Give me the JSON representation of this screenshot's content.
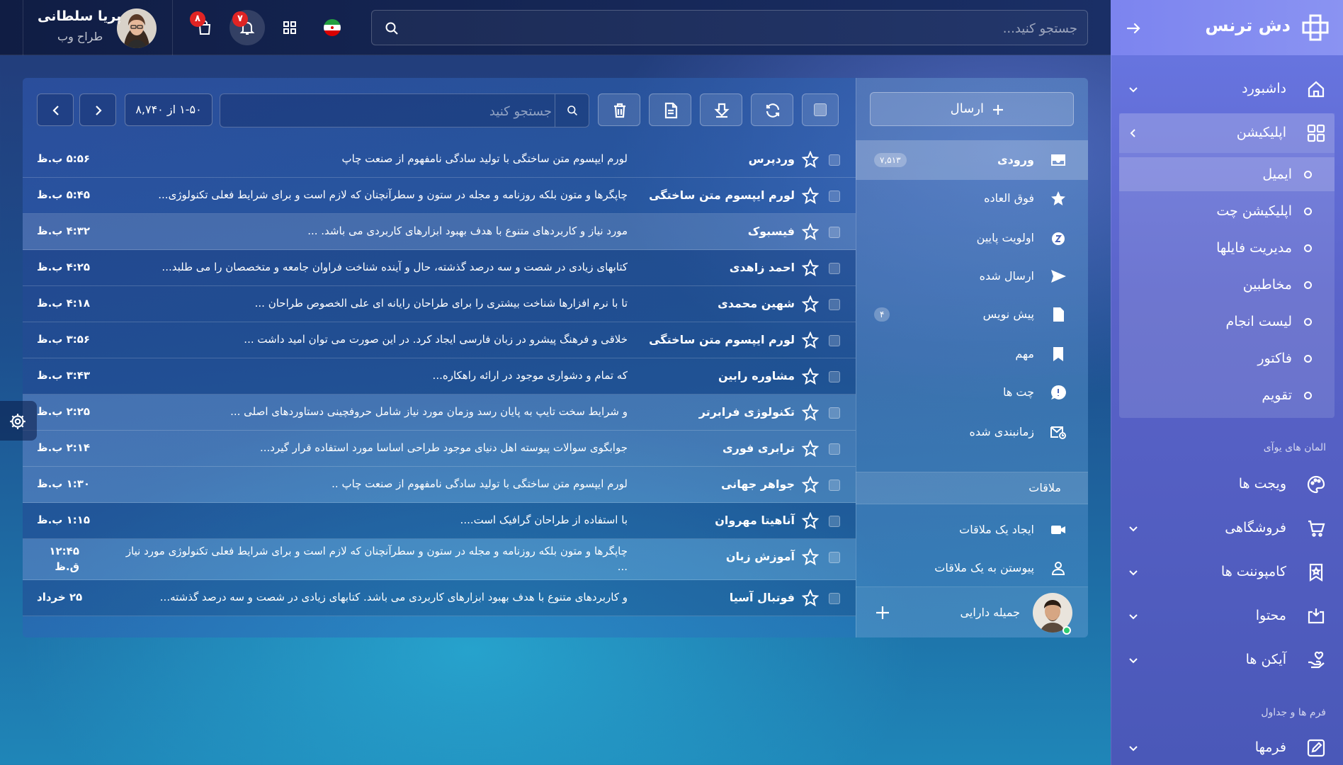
{
  "app": {
    "brand": "دش ترنس"
  },
  "topbar": {
    "search_placeholder": "جستجو کنید...",
    "flag": "iran-flag",
    "notifications_count": "۷",
    "cart_count": "۸",
    "user": {
      "name": "پریا سلطانی",
      "role": "طراح وب"
    }
  },
  "sidebar": {
    "dashboard": "داشبورد",
    "apps": "اپلیکیشن",
    "submenu": [
      {
        "label": "ایمیل",
        "active": true
      },
      {
        "label": "اپلیکیشن چت"
      },
      {
        "label": "مدیریت فایلها"
      },
      {
        "label": "مخاطبین"
      },
      {
        "label": "لیست انجام"
      },
      {
        "label": "فاکتور"
      },
      {
        "label": "تقویم"
      }
    ],
    "section_ui": "المان های یوآی",
    "widgets": "ویجت ها",
    "shop": "فروشگاهی",
    "components": "کامپوننت ها",
    "content": "محتوا",
    "icons": "آیکن ها",
    "section_forms": "فرم ها و جداول",
    "forms": "فرمها"
  },
  "mail": {
    "compose": "ارسال",
    "folders": [
      {
        "label": "ورودی",
        "count": "۷,۵۱۳",
        "icon": "inbox-icon"
      },
      {
        "label": "فوق العاده",
        "count": "",
        "icon": "star-icon"
      },
      {
        "label": "اولویت پایین",
        "count": "",
        "icon": "snooze-icon"
      },
      {
        "label": "ارسال شده",
        "count": "",
        "icon": "send-icon"
      },
      {
        "label": "پیش نویس",
        "count": "۴",
        "icon": "draft-icon"
      },
      {
        "label": "مهم",
        "count": "",
        "icon": "bookmark-icon"
      },
      {
        "label": "چت ها",
        "count": "",
        "icon": "chat-icon"
      },
      {
        "label": "زمانبندی شده",
        "count": "",
        "icon": "scheduled-icon"
      }
    ],
    "meetings_title": "ملاقات",
    "meetings": [
      {
        "label": "ایجاد یک ملاقات",
        "icon": "video-icon"
      },
      {
        "label": "پیوستن به یک ملاقات",
        "icon": "people-icon"
      }
    ],
    "contact": {
      "name": "جمیله دارایی"
    },
    "search_placeholder": "جستجو کنید",
    "pager": "۱-۵۰ از ۸,۷۴۰",
    "rows": [
      {
        "sender": "وردپرس",
        "subject": "لورم ایپسوم متن ساختگی با تولید سادگی نامفهوم از صنعت چاپ",
        "time": "۵:۵۶ ب.ظ"
      },
      {
        "sender": "لورم ایپسوم متن ساختگی",
        "subject": "چاپگرها و متون بلکه روزنامه و مجله در ستون و سطرآنچنان که لازم است و برای شرایط فعلی تکنولوژی...",
        "time": "۵:۴۵ ب.ظ"
      },
      {
        "sender": "فیسبوک",
        "subject": "مورد نیاز و کاربردهای متنوع با هدف بهبود ابزارهای کاربردی می باشد. ...",
        "time": "۴:۳۲ ب.ظ"
      },
      {
        "sender": "احمد زاهدی",
        "subject": "کتابهای زیادی در شصت و سه درصد گذشته، حال و آینده شناخت فراوان جامعه و متخصصان را می طلبد...",
        "time": "۴:۲۵ ب.ظ"
      },
      {
        "sender": "شهین محمدی",
        "subject": "تا با نرم افزارها شناخت بیشتری را برای طراحان رایانه ای علی الخصوص طراحان ...",
        "time": "۴:۱۸ ب.ظ"
      },
      {
        "sender": "لورم ایپسوم متن ساختگی",
        "subject": "خلاقی و فرهنگ پیشرو در زبان فارسی ایجاد کرد. در این صورت می توان امید داشت ...",
        "time": "۳:۵۶ ب.ظ"
      },
      {
        "sender": "مشاوره رابین",
        "subject": "که تمام و دشواری موجود در ارائه راهکاره...",
        "time": "۳:۴۳ ب.ظ"
      },
      {
        "sender": "تکنولوژی فرابرتر",
        "subject": "و شرایط سخت تایپ به پایان رسد وزمان مورد نیاز شامل حروفچینی دستاوردهای اصلی ...",
        "time": "۲:۲۵ ب.ظ"
      },
      {
        "sender": "ترابری فوری",
        "subject": "جوابگوی سوالات پیوسته اهل دنیای موجود طراحی اساسا مورد استفاده قرار گیرد...",
        "time": "۲:۱۴ ب.ظ"
      },
      {
        "sender": "جواهر جهانی",
        "subject": "لورم ایپسوم متن ساختگی با تولید سادگی نامفهوم از صنعت چاپ ..",
        "time": "۱:۳۰ ب.ظ"
      },
      {
        "sender": "آناهیتا مهروان",
        "subject": "با استفاده از طراحان گرافیک است....",
        "time": "۱:۱۵ ب.ظ"
      },
      {
        "sender": "آموزش زبان",
        "subject": "چاپگرها و متون بلکه روزنامه و مجله در ستون و سطرآنچنان که لازم است و برای شرایط فعلی تکنولوژی مورد نیاز ...",
        "time": "۱۲:۴۵ ق.ظ"
      },
      {
        "sender": "فوتبال آسیا",
        "subject": "و کاربردهای متنوع با هدف بهبود ابزارهای کاربردی می باشد. کتابهای زیادی در شصت و سه درصد گذشته...",
        "time": "۲۵ خرداد"
      }
    ]
  }
}
